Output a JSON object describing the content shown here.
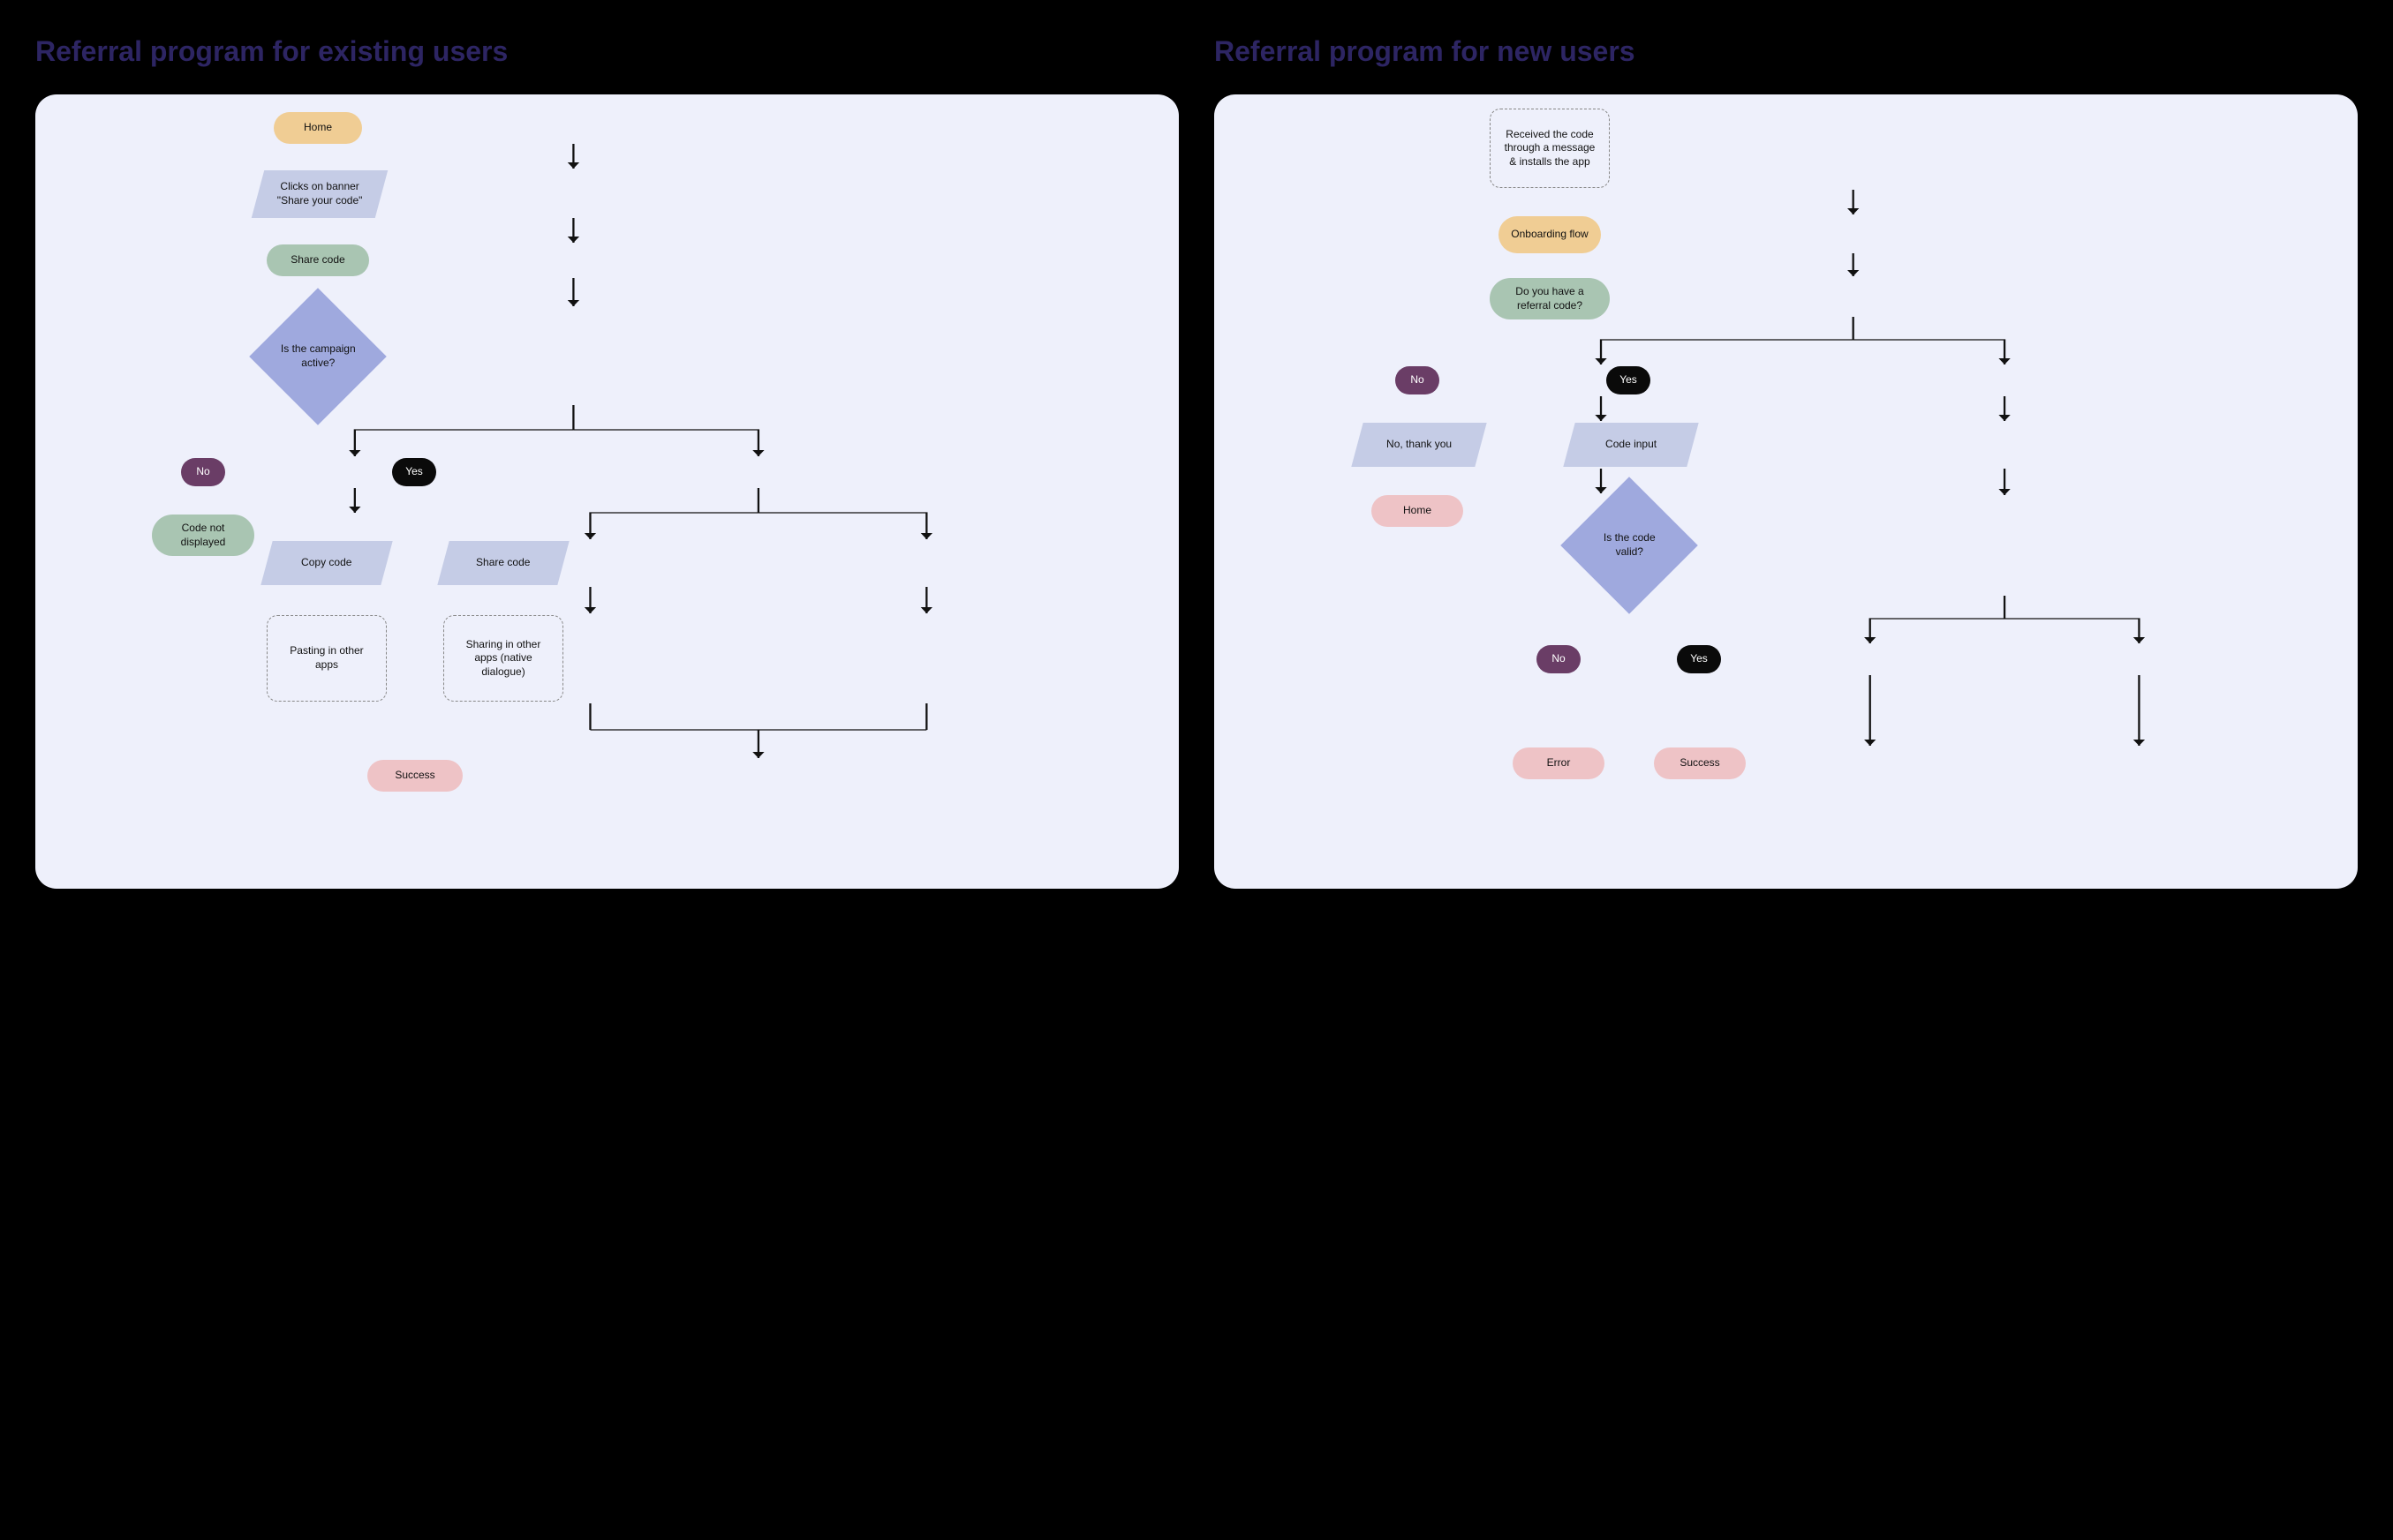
{
  "existing": {
    "title": "Referral program for existing users",
    "nodes": {
      "home": "Home",
      "click_banner": "Clicks on banner \"Share your code\"",
      "share_code": "Share code",
      "campaign_q": "Is the campaign active?",
      "no": "No",
      "yes": "Yes",
      "not_displayed": "Code not displayed",
      "copy_code": "Copy code",
      "share_code2": "Share code",
      "pasting": "Pasting in other apps",
      "sharing": "Sharing in other apps (native dialogue)",
      "success": "Success"
    }
  },
  "newu": {
    "title": "Referral program for new users",
    "nodes": {
      "received": "Received the code through a message & installs the app",
      "onboarding": "Onboarding flow",
      "have_code_q": "Do you have a referral code?",
      "no": "No",
      "yes": "Yes",
      "no_thanks": "No, thank you",
      "home": "Home",
      "code_input": "Code input",
      "valid_q": "Is the code valid?",
      "no2": "No",
      "yes2": "Yes",
      "error": "Error",
      "success": "Success"
    }
  }
}
